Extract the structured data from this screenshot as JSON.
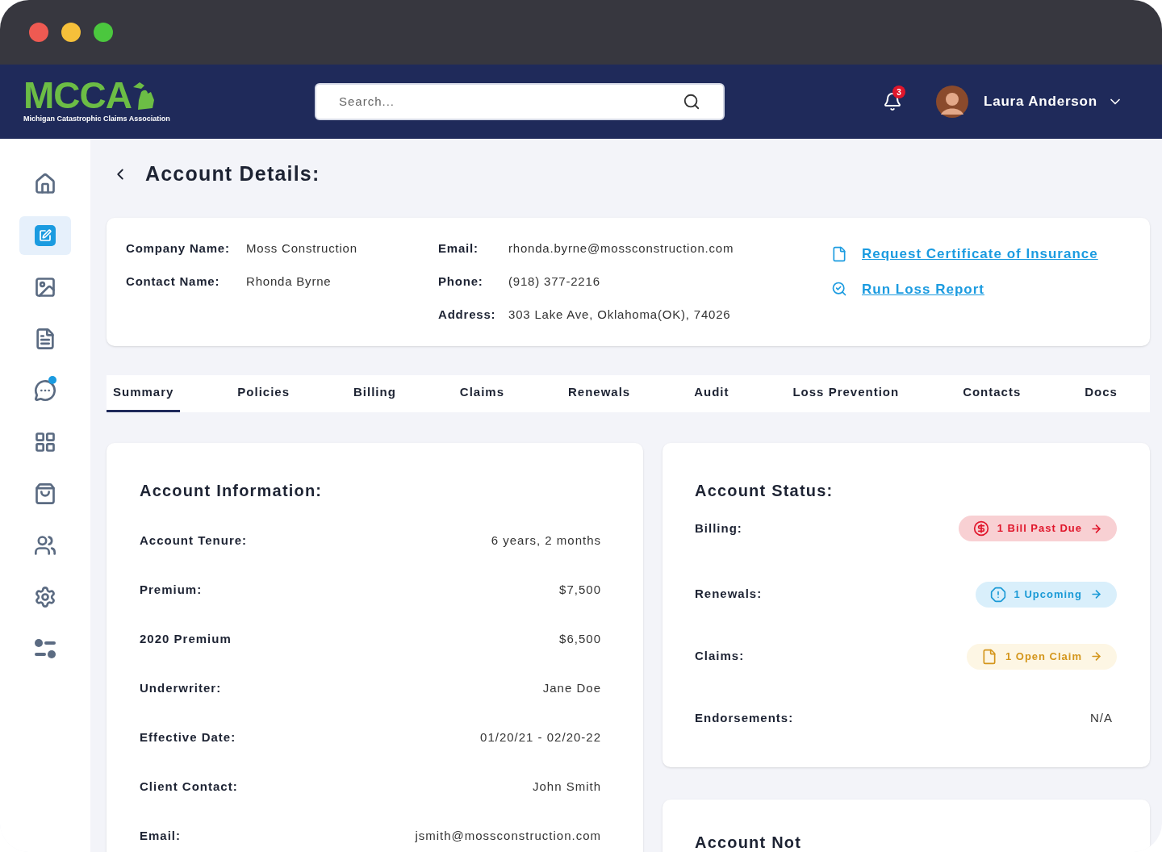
{
  "logo": {
    "text": "MCCA",
    "tagline": "Michigan Catastrophic Claims Association"
  },
  "search": {
    "placeholder": "Search..."
  },
  "notifications": {
    "count": "3"
  },
  "user": {
    "name": "Laura Anderson"
  },
  "sidebar": {
    "items": [
      {
        "selected": false,
        "dot": false
      },
      {
        "selected": true,
        "dot": false
      },
      {
        "selected": false,
        "dot": false
      },
      {
        "selected": false,
        "dot": false
      },
      {
        "selected": false,
        "dot": true
      },
      {
        "selected": false,
        "dot": false
      },
      {
        "selected": false,
        "dot": false
      },
      {
        "selected": false,
        "dot": false
      },
      {
        "selected": false,
        "dot": false
      },
      {
        "selected": false,
        "dot": false
      }
    ]
  },
  "page_title": "Account Details:",
  "account": {
    "columns": [
      [
        {
          "label": "Company Name:",
          "value": "Moss Construction"
        },
        {
          "label": "Contact Name:",
          "value": "Rhonda Byrne"
        }
      ],
      [
        {
          "label": "Email:",
          "value": "rhonda.byrne@mossconstruction.com"
        },
        {
          "label": "Phone:",
          "value": "(918) 377-2216"
        },
        {
          "label": "Address:",
          "value": "303 Lake Ave, Oklahoma(OK), 74026"
        }
      ]
    ],
    "links": [
      "Request Certificate of Insurance",
      "Run Loss Report"
    ]
  },
  "tabs": [
    {
      "label": "Summary",
      "selected": true
    },
    {
      "label": "Policies",
      "selected": false
    },
    {
      "label": "Billing",
      "selected": false
    },
    {
      "label": "Claims",
      "selected": false
    },
    {
      "label": "Renewals",
      "selected": false
    },
    {
      "label": "Audit",
      "selected": false
    },
    {
      "label": "Loss Prevention",
      "selected": false
    },
    {
      "label": "Contacts",
      "selected": false
    },
    {
      "label": "Docs",
      "selected": false
    }
  ],
  "account_information": {
    "title": "Account Information:",
    "rows": [
      {
        "label": "Account Tenure:",
        "value": "6 years, 2 months"
      },
      {
        "label": "Premium:",
        "value": "$7,500"
      },
      {
        "label": "2020 Premium",
        "value": "$6,500"
      },
      {
        "label": "Underwriter:",
        "value": "Jane Doe"
      },
      {
        "label": "Effective Date:",
        "value": "01/20/21 - 02/20-22"
      },
      {
        "label": "Client Contact:",
        "value": "John Smith"
      },
      {
        "label": "Email:",
        "value": "jsmith@mossconstruction.com"
      }
    ]
  },
  "account_status": {
    "title": "Account Status:",
    "rows": [
      {
        "label": "Billing:",
        "kind": "chip",
        "value": "1 Bill Past Due",
        "color": "#e0162b"
      },
      {
        "label": "Renewals:",
        "kind": "chip",
        "value": "1 Upcoming",
        "color": "#1a9ad6"
      },
      {
        "label": "Claims:",
        "kind": "chip",
        "value": "1 Open Claim",
        "color": "#d4961c"
      },
      {
        "label": "Endorsements:",
        "kind": "text",
        "value": "N/A"
      }
    ]
  },
  "notes": {
    "title": "Account Not"
  }
}
